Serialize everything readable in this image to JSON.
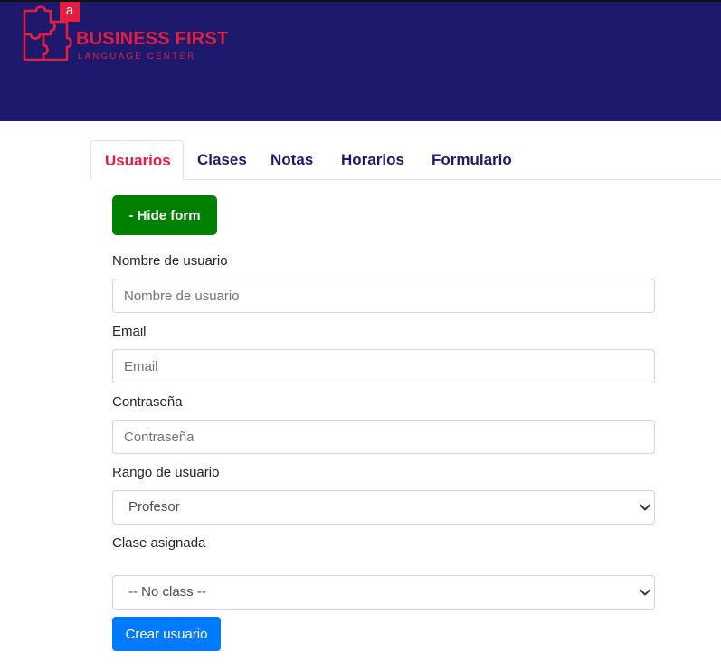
{
  "header": {
    "logo_letter": "a",
    "logo_title": "BUSINESS FIRST",
    "logo_subtitle": "LANGUAGE CENTER",
    "background": "#1d1a6e",
    "brand_color": "#e51e3f"
  },
  "tabs": [
    {
      "label": "Usuarios",
      "active": true
    },
    {
      "label": "Clases",
      "active": false
    },
    {
      "label": "Notas",
      "active": false
    },
    {
      "label": "Horarios",
      "active": false
    },
    {
      "label": "Formulario",
      "active": false
    }
  ],
  "form": {
    "toggle_label": "- Hide form",
    "username": {
      "label": "Nombre de usuario",
      "placeholder": "Nombre de usuario",
      "value": ""
    },
    "email": {
      "label": "Email",
      "placeholder": "Email",
      "value": ""
    },
    "password": {
      "label": "Contraseña",
      "placeholder": "Contraseña",
      "value": ""
    },
    "role": {
      "label": "Rango de usuario",
      "selected": "Profesor"
    },
    "class": {
      "label": "Clase asignada",
      "selected": "-- No class --"
    },
    "submit_label": "Crear usuario"
  },
  "colors": {
    "tab_active": "#e51e3f",
    "tab_inactive": "#1d1a6e",
    "hide_button": "#008000",
    "submit_button": "#007bff"
  },
  "icons": {
    "logo": "puzzle-logo-icon",
    "select_arrow": "chevron-down-icon"
  }
}
